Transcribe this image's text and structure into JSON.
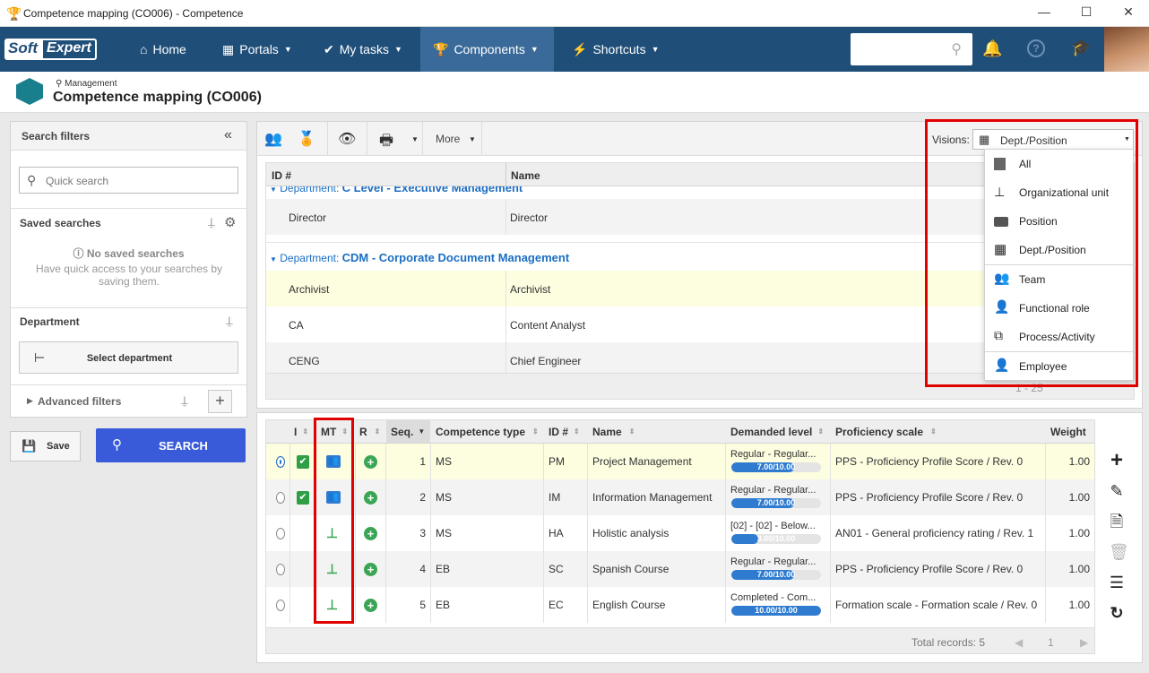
{
  "window": {
    "title": "Competence mapping (CO006) - Competence"
  },
  "nav": {
    "logo_a": "Soft",
    "logo_b": "Expert",
    "items": [
      "Home",
      "Portals",
      "My tasks",
      "Components",
      "Shortcuts"
    ]
  },
  "header": {
    "breadcrumb": "Management",
    "title": "Competence mapping (CO006)"
  },
  "filters": {
    "title": "Search filters",
    "quick_search_placeholder": "Quick search",
    "saved_title": "Saved searches",
    "no_saved": "No saved searches",
    "no_saved_hint": "Have quick access to your searches by saving them.",
    "department_title": "Department",
    "select_department": "Select department",
    "advanced": "Advanced filters",
    "save": "Save",
    "search": "SEARCH"
  },
  "toolbar": {
    "more": "More"
  },
  "visions": {
    "label": "Visions:",
    "selected": "Dept./Position",
    "options": [
      "All",
      "Organizational unit",
      "Position",
      "Dept./Position",
      "Team",
      "Functional role",
      "Process/Activity",
      "Employee"
    ]
  },
  "upper_grid": {
    "columns": [
      "ID #",
      "Name"
    ],
    "group_prefix": "Department:",
    "groups": [
      {
        "name": "C Level - Executive Management",
        "rows": [
          {
            "id": "Director",
            "name": "Director"
          }
        ]
      },
      {
        "name": "CDM - Corporate Document Management",
        "rows": [
          {
            "id": "Archivist",
            "name": "Archivist"
          },
          {
            "id": "CA",
            "name": "Content Analyst"
          },
          {
            "id": "CENG",
            "name": "Chief Engineer"
          }
        ]
      }
    ],
    "pager": "1 - 25"
  },
  "lower_grid": {
    "columns": [
      "I",
      "MT",
      "R",
      "Seq.",
      "Competence type",
      "ID #",
      "Name",
      "Demanded level",
      "Proficiency scale",
      "Weight"
    ],
    "rows": [
      {
        "seq": "1",
        "type": "MS",
        "id": "PM",
        "name": "Project Management",
        "level": "Regular - Regular...",
        "score": "7.00/10.00",
        "frac": 0.7,
        "scale": "PPS - Proficiency Profile Score / Rev. 0",
        "weight": "1.00",
        "checked": true,
        "mt": "team",
        "selected": true
      },
      {
        "seq": "2",
        "type": "MS",
        "id": "IM",
        "name": "Information Management",
        "level": "Regular - Regular...",
        "score": "7.00/10.00",
        "frac": 0.7,
        "scale": "PPS - Proficiency Profile Score / Rev. 0",
        "weight": "1.00",
        "checked": true,
        "mt": "team",
        "selected": false
      },
      {
        "seq": "3",
        "type": "MS",
        "id": "HA",
        "name": "Holistic analysis",
        "level": "[02] - [02] - Below...",
        "score": "3.00/10.00",
        "frac": 0.3,
        "scale": "AN01 - General proficiency rating / Rev. 1",
        "weight": "1.00",
        "checked": false,
        "mt": "org",
        "selected": false
      },
      {
        "seq": "4",
        "type": "EB",
        "id": "SC",
        "name": "Spanish Course",
        "level": "Regular - Regular...",
        "score": "7.00/10.00",
        "frac": 0.7,
        "scale": "PPS - Proficiency Profile Score / Rev. 0",
        "weight": "1.00",
        "checked": false,
        "mt": "org",
        "selected": false
      },
      {
        "seq": "5",
        "type": "EB",
        "id": "EC",
        "name": "English Course",
        "level": "Completed - Com...",
        "score": "10.00/10.00",
        "frac": 1.0,
        "scale": "Formation scale - Formation scale / Rev. 0",
        "weight": "1.00",
        "checked": false,
        "mt": "org",
        "selected": false
      }
    ],
    "total_records": "Total records: 5",
    "page": "1"
  },
  "colors": {
    "navbar": "#1f4e79",
    "accent": "#3a5bd9",
    "highlight": "#e00000",
    "green": "#3aa655"
  }
}
